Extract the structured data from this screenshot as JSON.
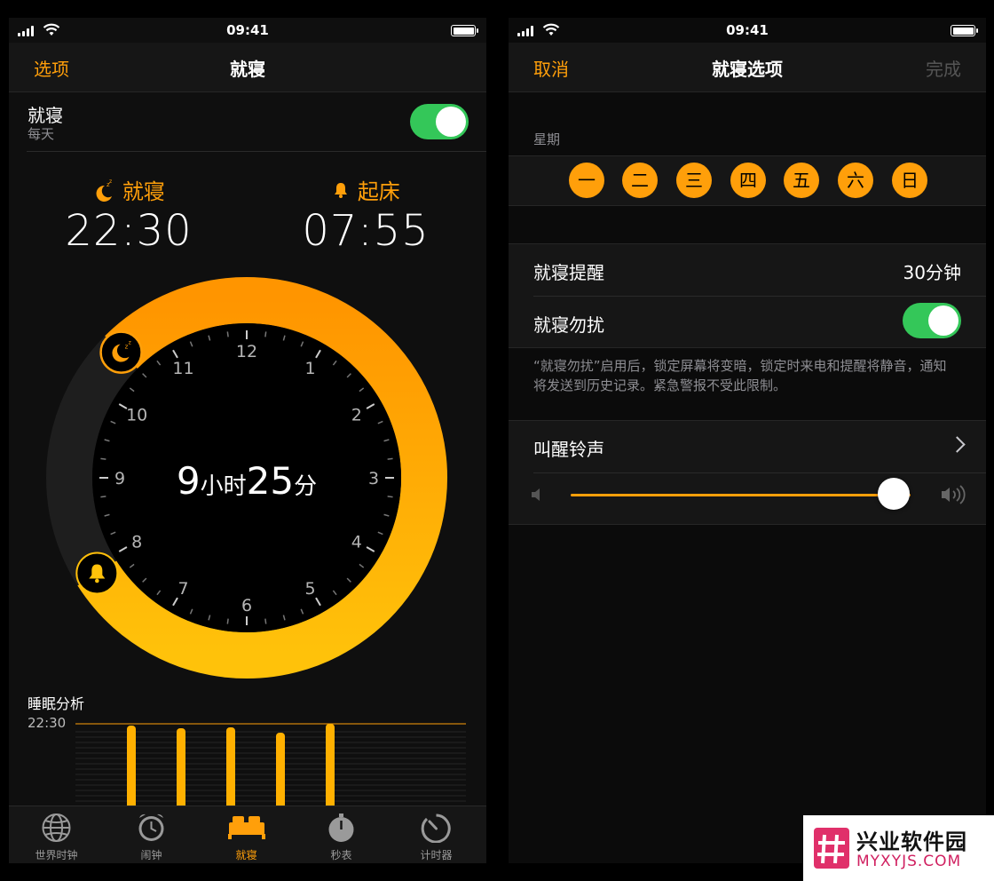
{
  "status": {
    "time": "09:41"
  },
  "p1": {
    "nav": {
      "left": "选项",
      "title": "就寝"
    },
    "bedtime_row": {
      "label": "就寝",
      "sub": "每天",
      "enabled": true
    },
    "bedtime": {
      "label": "就寝",
      "time": "22:30"
    },
    "wake": {
      "label": "起床",
      "time": "07:55"
    },
    "duration": {
      "hours": "9",
      "hour_unit": "小时",
      "minutes": "25",
      "minute_unit": "分"
    },
    "dial_numbers": [
      "12",
      "1",
      "2",
      "3",
      "4",
      "5",
      "6",
      "7",
      "8",
      "9",
      "10",
      "11"
    ],
    "sleep_analysis": {
      "title": "睡眠分析",
      "reference_time": "22:30",
      "bar_heights": [
        0.93,
        0.9,
        0.91,
        0.85,
        0.95
      ]
    },
    "tabs": [
      {
        "label": "世界时钟",
        "icon": "globe-icon"
      },
      {
        "label": "闹钟",
        "icon": "alarm-clock-icon"
      },
      {
        "label": "就寝",
        "icon": "bed-icon",
        "active": true
      },
      {
        "label": "秒表",
        "icon": "stopwatch-icon"
      },
      {
        "label": "计时器",
        "icon": "timer-icon"
      }
    ]
  },
  "p2": {
    "nav": {
      "left": "取消",
      "title": "就寝选项",
      "right": "完成"
    },
    "weekday_label": "星期",
    "days": [
      "一",
      "二",
      "三",
      "四",
      "五",
      "六",
      "日"
    ],
    "reminder": {
      "label": "就寝提醒",
      "value": "30分钟"
    },
    "dnd": {
      "label": "就寝勿扰",
      "enabled": true
    },
    "dnd_note": "“就寝勿扰”启用后，锁定屏幕将变暗，锁定时来电和提醒将静音，通知将发送到历史记录。紧急警报不受此限制。",
    "wake_sound": {
      "label": "叫醒铃声"
    },
    "volume": 0.95
  },
  "watermark": {
    "name": "兴业软件园",
    "url": "MYXYJS.COM"
  },
  "colors": {
    "accent": "#ff9f0a",
    "toggle": "#34c759"
  }
}
